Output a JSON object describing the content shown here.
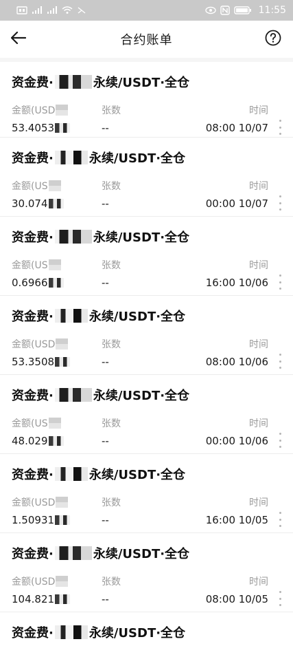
{
  "status_bar": {
    "time": "11:55"
  },
  "header": {
    "title": "合约账单"
  },
  "columns": {
    "amount": "金额(USD",
    "amount_short": "金额(US",
    "quantity": "张数",
    "time": "时间"
  },
  "items": [
    {
      "title_prefix": "资金费·",
      "title_suffix": "永续/USDT·全仓",
      "amount": "53.4053",
      "quantity": "--",
      "time": "08:00 10/07"
    },
    {
      "title_prefix": "资金费·",
      "title_suffix": "永续/USDT·全仓",
      "amount": "30.074",
      "quantity": "--",
      "time": "00:00 10/07"
    },
    {
      "title_prefix": "资金费·",
      "title_suffix": "永续/USDT·全仓",
      "amount": "0.6966",
      "quantity": "--",
      "time": "16:00 10/06"
    },
    {
      "title_prefix": "资金费·",
      "title_suffix": "永续/USDT·全仓",
      "amount": "53.3508",
      "quantity": "--",
      "time": "08:00 10/06"
    },
    {
      "title_prefix": "资金费·",
      "title_suffix": "永续/USDT·全仓",
      "amount": "48.029",
      "quantity": "--",
      "time": "00:00 10/06"
    },
    {
      "title_prefix": "资金费·",
      "title_suffix": "永续/USDT·全仓",
      "amount": "1.50931",
      "quantity": "--",
      "time": "16:00 10/05"
    },
    {
      "title_prefix": "资金费·",
      "title_suffix": "永续/USDT·全仓",
      "amount": "104.821",
      "quantity": "--",
      "time": "08:00 10/05"
    },
    {
      "title_prefix": "资金费·",
      "title_suffix": "永续/USDT·全仓"
    }
  ],
  "icons": {
    "back": "arrow-left-icon",
    "help": "help-circle-icon",
    "more": "more-vertical-icon"
  },
  "colors": {
    "status_bar_bg": "#c9c9c9",
    "label": "#9a9a9a",
    "text": "#1a1a1a"
  }
}
